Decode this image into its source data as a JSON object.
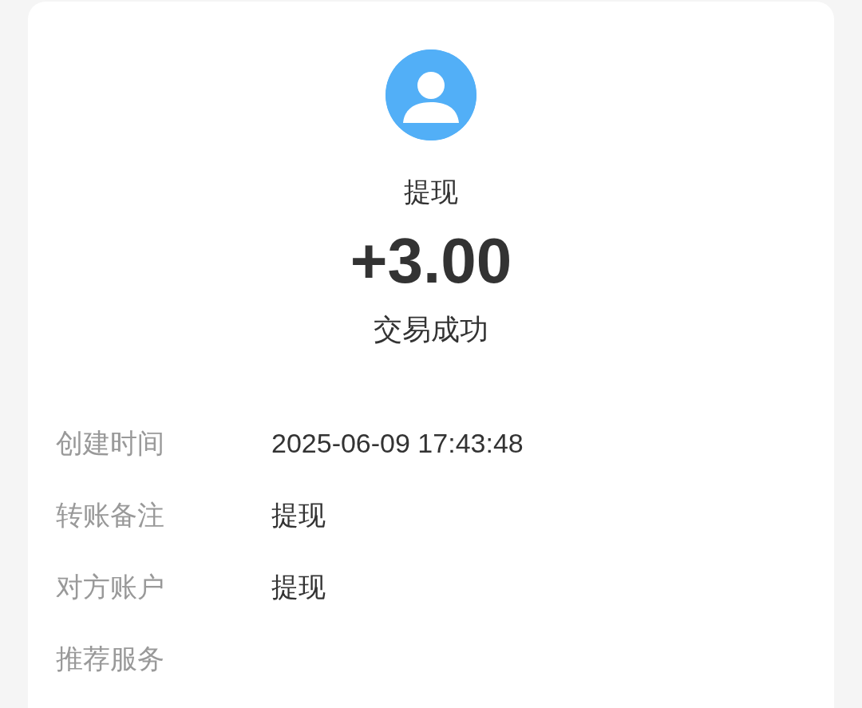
{
  "header": {
    "title": "提现",
    "amount": "+3.00",
    "status": "交易成功"
  },
  "details": [
    {
      "label": "创建时间",
      "value": "2025-06-09 17:43:48"
    },
    {
      "label": "转账备注",
      "value": "提现"
    },
    {
      "label": "对方账户",
      "value": "提现"
    },
    {
      "label": "推荐服务"
    }
  ]
}
